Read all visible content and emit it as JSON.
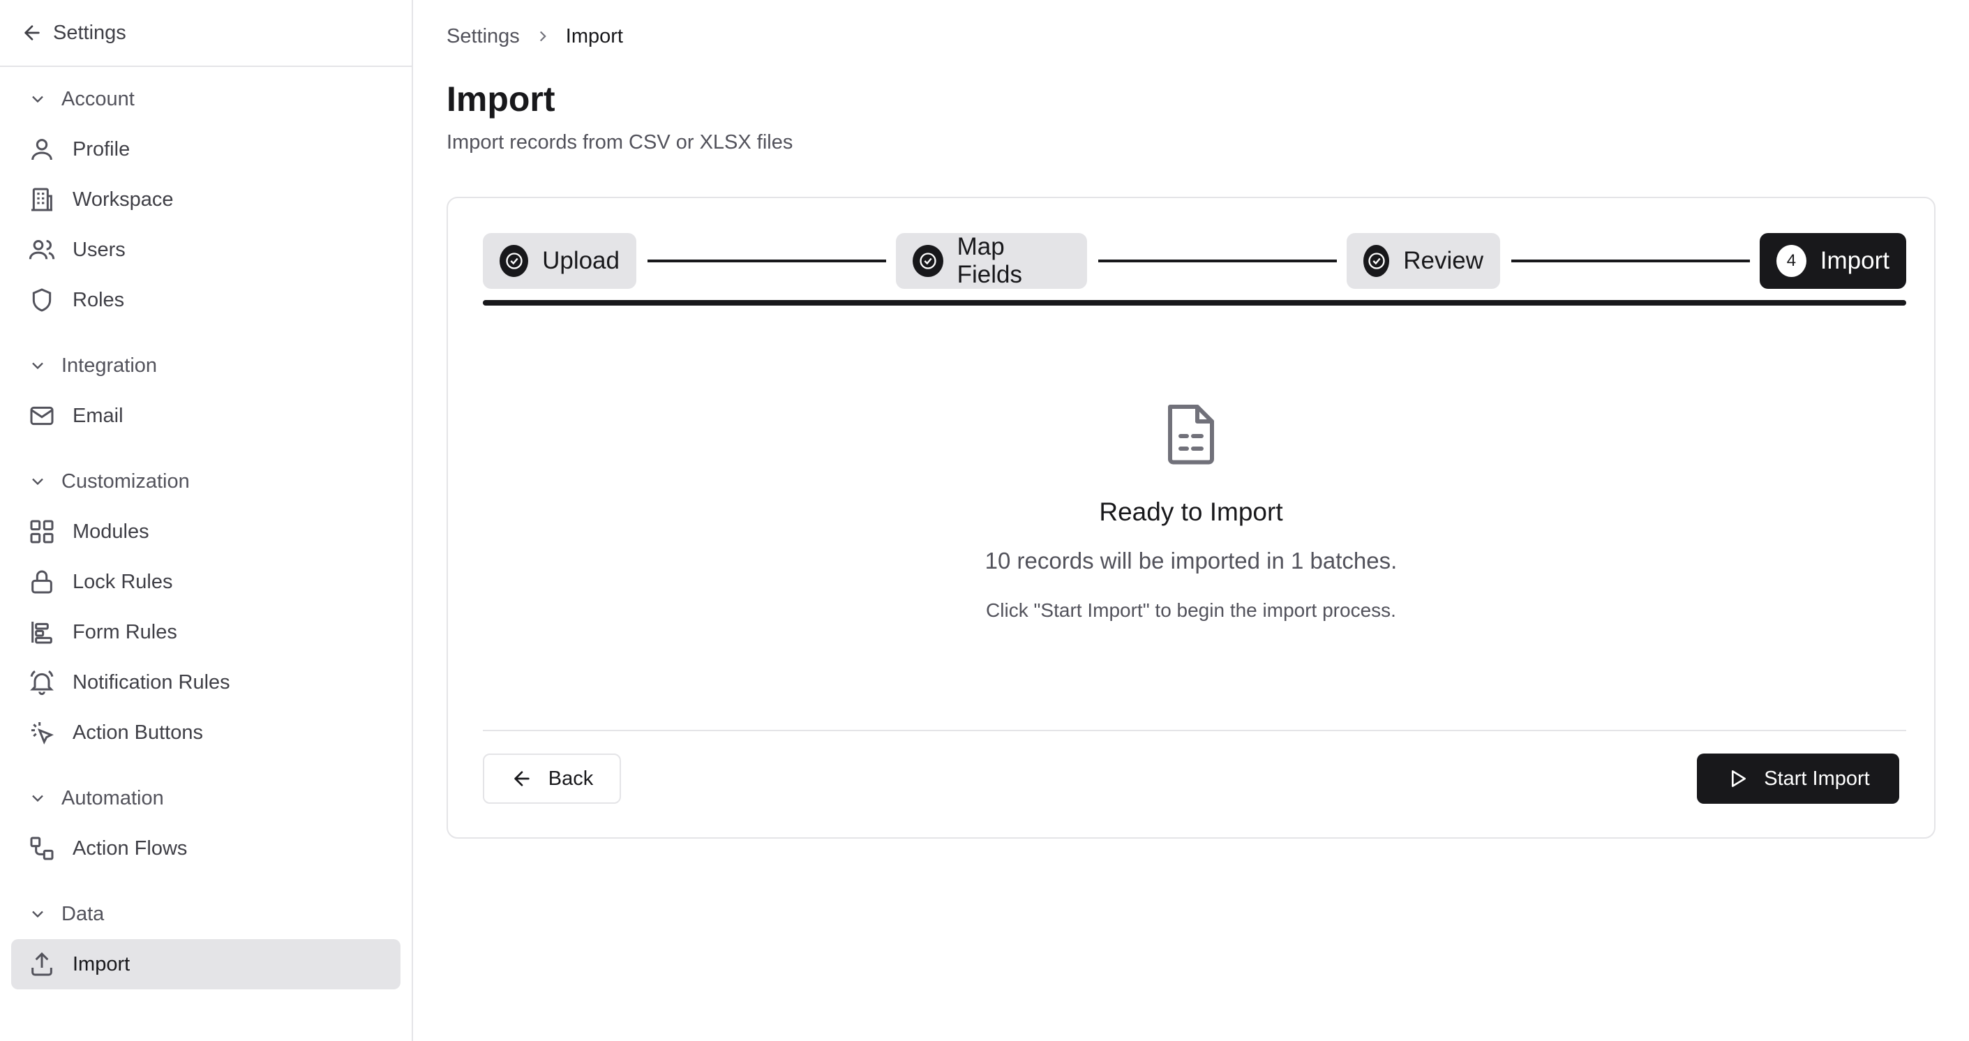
{
  "sidebar": {
    "back_label": "Settings",
    "sections": [
      {
        "label": "Account",
        "items": [
          {
            "label": "Profile",
            "icon": "user-icon"
          },
          {
            "label": "Workspace",
            "icon": "building-icon"
          },
          {
            "label": "Users",
            "icon": "users-icon"
          },
          {
            "label": "Roles",
            "icon": "shield-icon"
          }
        ]
      },
      {
        "label": "Integration",
        "items": [
          {
            "label": "Email",
            "icon": "mail-icon"
          }
        ]
      },
      {
        "label": "Customization",
        "items": [
          {
            "label": "Modules",
            "icon": "grid-icon"
          },
          {
            "label": "Lock Rules",
            "icon": "lock-icon"
          },
          {
            "label": "Form Rules",
            "icon": "align-left-icon"
          },
          {
            "label": "Notification Rules",
            "icon": "bell-icon"
          },
          {
            "label": "Action Buttons",
            "icon": "pointer-click-icon"
          }
        ]
      },
      {
        "label": "Automation",
        "items": [
          {
            "label": "Action Flows",
            "icon": "workflow-icon"
          }
        ]
      },
      {
        "label": "Data",
        "items": [
          {
            "label": "Import",
            "icon": "upload-icon",
            "active": true
          }
        ]
      }
    ]
  },
  "breadcrumb": {
    "parent": "Settings",
    "current": "Import"
  },
  "page": {
    "title": "Import",
    "subtitle": "Import records from CSV or XLSX files"
  },
  "stepper": {
    "steps": [
      {
        "label": "Upload",
        "state": "complete"
      },
      {
        "label": "Map Fields",
        "state": "complete"
      },
      {
        "label": "Review",
        "state": "complete"
      },
      {
        "label": "Import",
        "state": "active",
        "number": "4"
      }
    ],
    "progress_fraction": 1.0
  },
  "content": {
    "icon": "file-spreadsheet-icon",
    "title": "Ready to Import",
    "description": "10 records will be imported in 1 batches.",
    "hint": "Click \"Start Import\" to begin the import process."
  },
  "actions": {
    "back_label": "Back",
    "start_label": "Start Import"
  },
  "colors": {
    "primary": "#18181b",
    "muted": "#e4e4e7",
    "text_muted": "#52525b"
  }
}
